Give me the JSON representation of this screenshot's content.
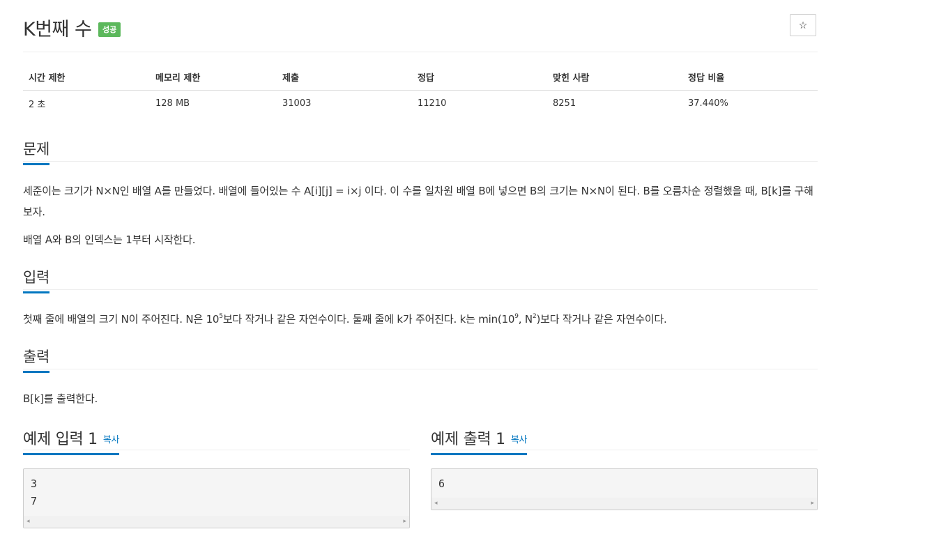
{
  "problem": {
    "title": "K번째 수",
    "status_badge": "성공",
    "star_icon": "☆"
  },
  "info_table": {
    "headers": [
      "시간 제한",
      "메모리 제한",
      "제출",
      "정답",
      "맞힌 사람",
      "정답 비율"
    ],
    "values": [
      "2 초",
      "128 MB",
      "31003",
      "11210",
      "8251",
      "37.440%"
    ]
  },
  "sections": {
    "problem_heading": "문제",
    "problem_text_1": "세준이는 크기가 N×N인 배열 A를 만들었다. 배열에 들어있는 수 A[i][j] = i×j 이다. 이 수를 일차원 배열 B에 넣으면 B의 크기는 N×N이 된다. B를 오름차순 정렬했을 때, B[k]를 구해보자.",
    "problem_text_2": "배열 A와 B의 인덱스는 1부터 시작한다.",
    "input_heading": "입력",
    "input_text": {
      "p1": "첫째 줄에 배열의 크기 N이 주어진다. N은 10",
      "sup1": "5",
      "p2": "보다 작거나 같은 자연수이다. 둘째 줄에 k가 주어진다. k는 min(10",
      "sup2": "9",
      "p3": ", N",
      "sup3": "2",
      "p4": ")보다 작거나 같은 자연수이다."
    },
    "output_heading": "출력",
    "output_text": "B[k]를 출력한다."
  },
  "samples": {
    "input_title": "예제 입력 1",
    "output_title": "예제 출력 1",
    "copy_label": "복사",
    "input_lines": "3\n7",
    "output_lines": "6",
    "scroll_left_icon": "◂",
    "scroll_right_icon": "▸"
  }
}
